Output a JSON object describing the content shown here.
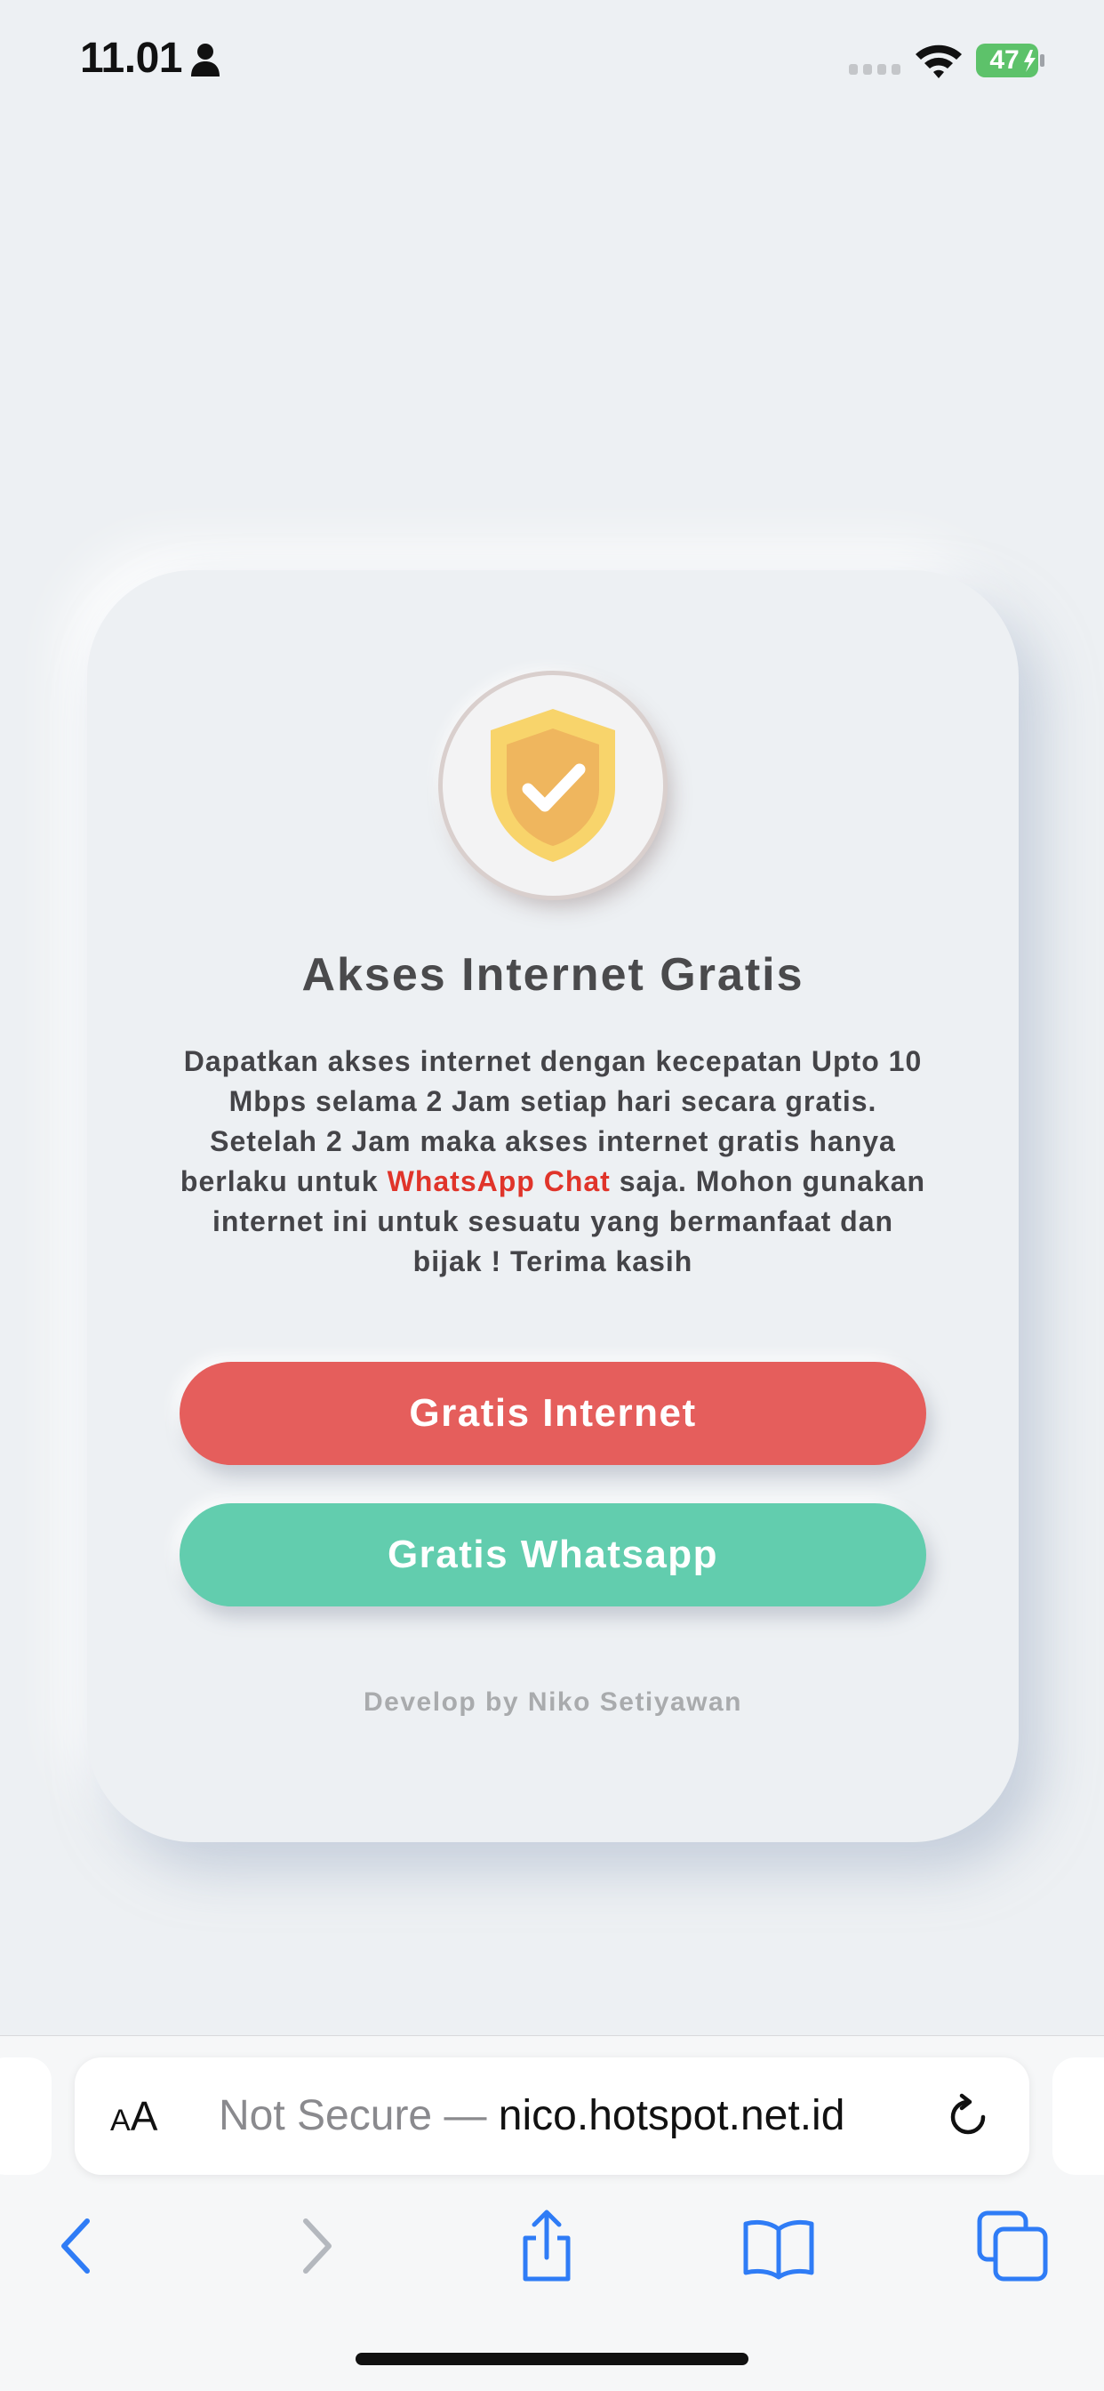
{
  "status_bar": {
    "time": "11.01",
    "battery_level": "47",
    "battery_color": "#5dc26a",
    "icons": [
      "person-icon",
      "signal-icon",
      "wifi-icon",
      "battery-icon"
    ]
  },
  "card": {
    "title": "Akses Internet Gratis",
    "description_before": "Dapatkan akses internet dengan kecepatan Upto 10 Mbps selama 2 Jam setiap hari secara gratis. Setelah 2 Jam maka akses internet gratis hanya berlaku untuk ",
    "description_highlight": "WhatsApp Chat",
    "description_after": " saja. Mohon gunakan internet ini untuk sesuatu yang bermanfaat dan bijak ! Terima kasih",
    "internet_button_label": "Gratis Internet",
    "whatsapp_button_label": "Gratis Whatsapp",
    "developer_credit": "Develop by Niko Setiyawan",
    "icon": "shield-check-icon"
  },
  "colors": {
    "background": "#edf0f3",
    "internet_button": "#e55e5c",
    "whatsapp_button": "#62cdae",
    "highlight_text": "#e0342a",
    "shield": "#f8d46b"
  },
  "browser": {
    "text_size_label_small": "A",
    "text_size_label_large": "A",
    "security_label": "Not Secure —",
    "url": "nico.hotspot.net.id",
    "toolbar_icons": [
      "back-icon",
      "forward-icon",
      "share-icon",
      "bookmarks-icon",
      "tabs-icon",
      "reload-icon"
    ]
  }
}
